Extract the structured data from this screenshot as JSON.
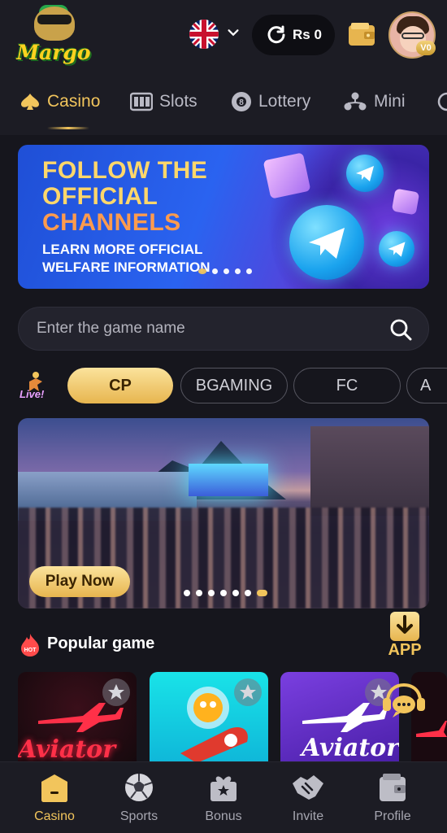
{
  "header": {
    "logo_text": "Margo",
    "language": "English (UK flag)",
    "balance": "Rs 0",
    "vip_level": "V0"
  },
  "categories": [
    {
      "label": "Casino",
      "active": true
    },
    {
      "label": "Slots",
      "active": false
    },
    {
      "label": "Lottery",
      "active": false
    },
    {
      "label": "Mini",
      "active": false
    }
  ],
  "banner": {
    "line1": "FOLLOW THE",
    "line2": "OFFICIAL",
    "line3": "CHANNELS",
    "sub1": "LEARN MORE OFFICIAL",
    "sub2": "WELFARE INFORMATION",
    "dots": 5,
    "active_dot": 0
  },
  "search": {
    "placeholder": "Enter the game name"
  },
  "providers": [
    {
      "label": "CP",
      "active": true
    },
    {
      "label": "BGAMING",
      "active": false
    },
    {
      "label": "FC",
      "active": false
    },
    {
      "label": "A",
      "active": false
    }
  ],
  "hero": {
    "cta": "Play Now",
    "dots": 7,
    "active_dot": 6
  },
  "popular": {
    "title": "Popular game",
    "app_label": "APP",
    "games": [
      {
        "title": "Aviator"
      },
      {
        "title": ""
      },
      {
        "title": "Aviator"
      },
      {
        "title": ""
      }
    ]
  },
  "bottom_nav": [
    {
      "label": "Casino",
      "icon": "casino-icon",
      "active": true
    },
    {
      "label": "Sports",
      "icon": "soccer-ball-icon",
      "active": false
    },
    {
      "label": "Bonus",
      "icon": "gift-icon",
      "active": false
    },
    {
      "label": "Invite",
      "icon": "handshake-icon",
      "active": false
    },
    {
      "label": "Profile",
      "icon": "wallet-icon",
      "active": false
    }
  ],
  "colors": {
    "background": "#16161d",
    "accent_gold": "#f2c55c",
    "surface": "#1c1c24"
  }
}
